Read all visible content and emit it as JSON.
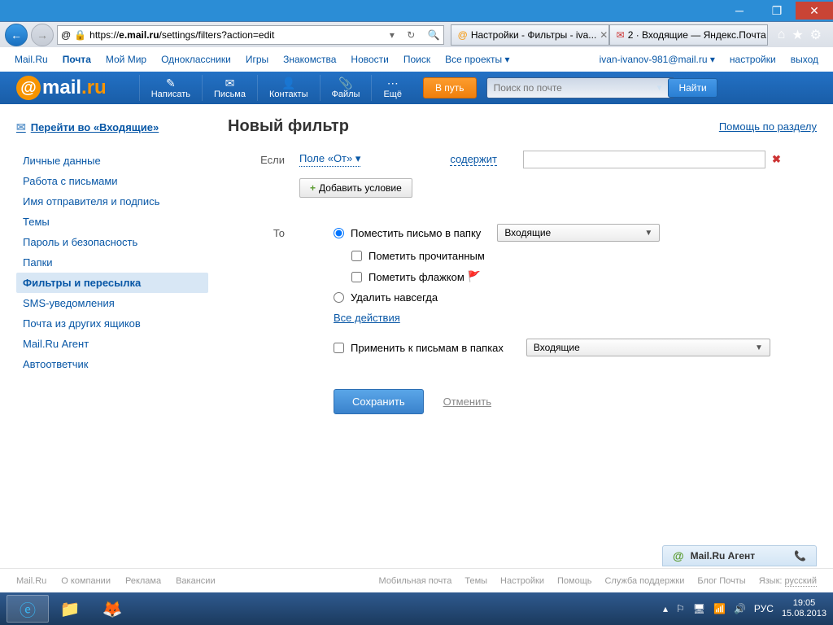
{
  "browser": {
    "url_domain": "e.mail.ru",
    "url_path": "/settings/filters?action=edit",
    "tab1": "Настройки - Фильтры - iva...",
    "tab2": "2 · Входящие — Яндекс.Почта"
  },
  "topnav": {
    "items": [
      "Mail.Ru",
      "Почта",
      "Мой Мир",
      "Одноклассники",
      "Игры",
      "Знакомства",
      "Новости",
      "Поиск",
      "Все проекты"
    ],
    "email": "ivan-ivanov-981@mail.ru",
    "settings": "настройки",
    "logout": "выход"
  },
  "header": {
    "tools": {
      "write": "Написать",
      "mail": "Письма",
      "contacts": "Контакты",
      "files": "Файлы",
      "more": "Ещё"
    },
    "go_btn": "В путь",
    "search_ph": "Поиск по почте",
    "find": "Найти"
  },
  "sidebar": {
    "inbox": "Перейти во «Входящие»",
    "items": [
      "Личные данные",
      "Работа с письмами",
      "Имя отправителя и подпись",
      "Темы",
      "Пароль и безопасность",
      "Папки",
      "Фильтры и пересылка",
      "SMS-уведомления",
      "Почта из других ящиков",
      "Mail.Ru Агент",
      "Автоответчик"
    ]
  },
  "pane": {
    "title": "Новый фильтр",
    "help": "Помощь по разделу",
    "if_label": "Если",
    "from_field": "Поле «От»",
    "contains": "содержит",
    "add_cond": "Добавить условие",
    "to_label": "То",
    "move_to": "Поместить письмо в папку",
    "folder_inbox": "Входящие",
    "mark_read": "Пометить прочитанным",
    "mark_flag": "Пометить флажком",
    "delete": "Удалить навсегда",
    "all_actions": "Все действия",
    "apply_folders": "Применить к письмам в папках",
    "apply_folder_val": "Входящие",
    "save": "Сохранить",
    "cancel": "Отменить"
  },
  "agent": "Mail.Ru Агент",
  "footer": {
    "left": [
      "Mail.Ru",
      "О компании",
      "Реклама",
      "Вакансии"
    ],
    "right": [
      "Мобильная почта",
      "Темы",
      "Настройки",
      "Помощь",
      "Служба поддержки",
      "Блог Почты"
    ],
    "lang_lbl": "Язык:",
    "lang": "русский"
  },
  "taskbar": {
    "lang": "РУС",
    "time": "19:05",
    "date": "15.08.2013"
  }
}
